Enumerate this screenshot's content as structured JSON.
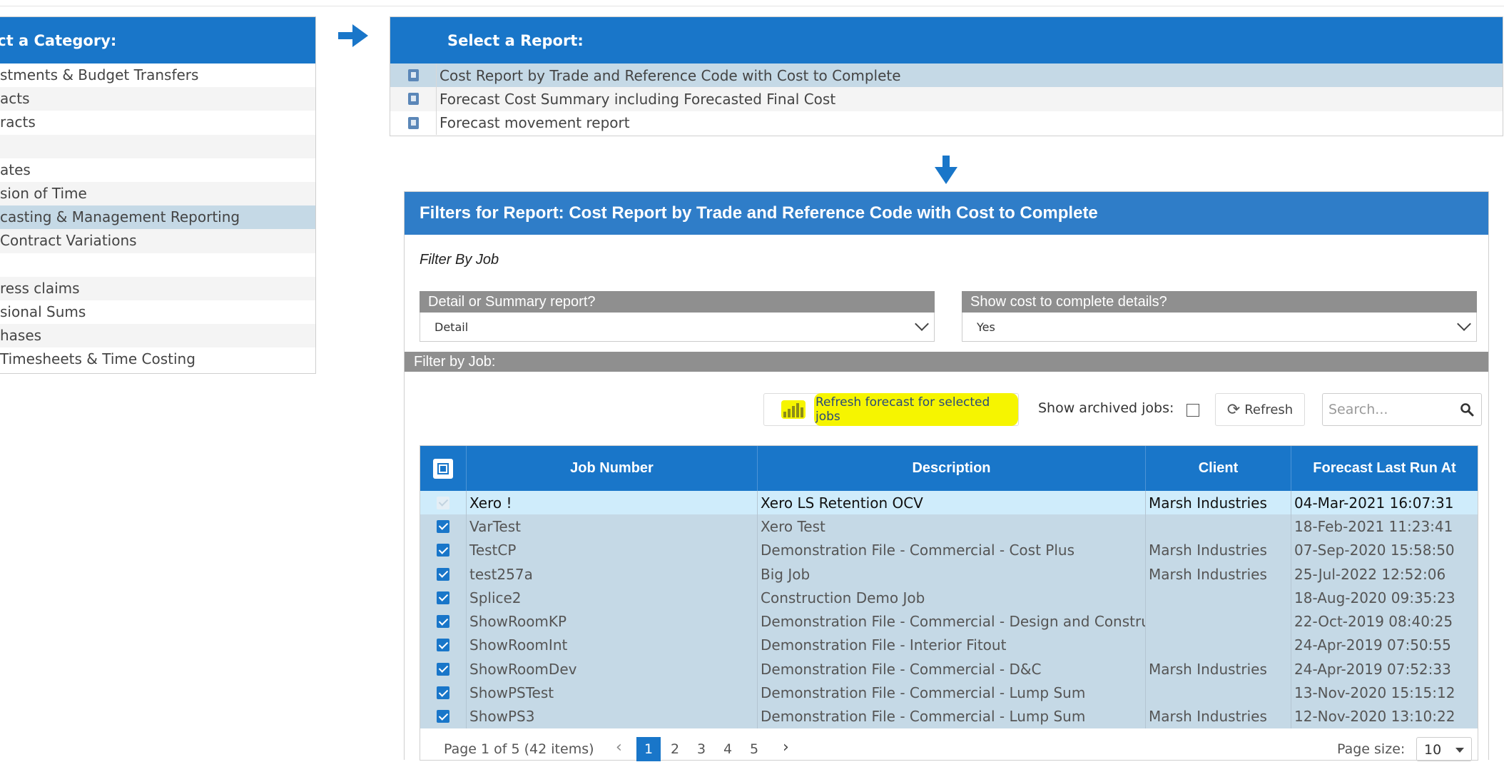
{
  "category_panel": {
    "header": "ect a Category:",
    "items": [
      "stments & Budget Transfers",
      "acts",
      "racts",
      "",
      "ates",
      "sion of Time",
      "casting & Management Reporting",
      " Contract Variations",
      "",
      "ress claims",
      "sional Sums",
      "hases",
      " Timesheets & Time Costing"
    ],
    "selected_index": 6
  },
  "report_panel": {
    "header": "Select a Report:",
    "items": [
      "Cost Report by Trade and Reference Code with Cost to Complete",
      "Forecast Cost Summary including Forecasted Final Cost",
      "Forecast movement report"
    ],
    "selected_index": 0
  },
  "filters": {
    "header": "Filters for Report: Cost Report by Trade and Reference Code with Cost to Complete",
    "filter_by_label": "Filter By Job",
    "detail_select": {
      "title": "Detail or Summary report?",
      "value": "Detail"
    },
    "cost_select": {
      "title": "Show cost to complete details?",
      "value": "Yes"
    },
    "job_bar": "Filter by Job:",
    "toolbar": {
      "forecast_button": "Refresh forecast for selected jobs",
      "archived_label": "Show archived jobs:",
      "refresh_button": "Refresh",
      "search_placeholder": "Search..."
    }
  },
  "grid": {
    "columns": [
      "Job Number",
      "Description",
      "Client",
      "Forecast Last Run At"
    ],
    "rows": [
      {
        "job": "Xero !",
        "description": "Xero LS Retention OCV",
        "client": "Marsh Industries",
        "forecast": "04-Mar-2021 16:07:31"
      },
      {
        "job": "VarTest",
        "description": "Xero Test",
        "client": "",
        "forecast": "18-Feb-2021 11:23:41"
      },
      {
        "job": "TestCP",
        "description": "Demonstration File - Commercial - Cost Plus",
        "client": "Marsh Industries",
        "forecast": "07-Sep-2020 15:58:50"
      },
      {
        "job": "test257a",
        "description": "Big Job",
        "client": "Marsh Industries",
        "forecast": "25-Jul-2022 12:52:06"
      },
      {
        "job": "Splice2",
        "description": "Construction Demo Job",
        "client": "",
        "forecast": "18-Aug-2020 09:35:23"
      },
      {
        "job": "ShowRoomKP",
        "description": "Demonstration File - Commercial - Design and Construct",
        "client": "",
        "forecast": "22-Oct-2019 08:40:25"
      },
      {
        "job": "ShowRoomInt",
        "description": "Demonstration File - Interior Fitout",
        "client": "",
        "forecast": "24-Apr-2019 07:50:55"
      },
      {
        "job": "ShowRoomDev",
        "description": "Demonstration File - Commercial - D&C",
        "client": "Marsh Industries",
        "forecast": "24-Apr-2019 07:52:33"
      },
      {
        "job": "ShowPSTest",
        "description": "Demonstration File - Commercial - Lump Sum",
        "client": "",
        "forecast": "13-Nov-2020 15:15:12"
      },
      {
        "job": "ShowPS3",
        "description": "Demonstration File - Commercial - Lump Sum",
        "client": "Marsh Industries",
        "forecast": "12-Nov-2020 13:10:22"
      }
    ]
  },
  "pager": {
    "info": "Page 1 of 5 (42 items)",
    "pages": [
      "1",
      "2",
      "3",
      "4",
      "5"
    ],
    "current_page": "1",
    "page_size_label": "Page size:",
    "page_size": "10"
  },
  "colors": {
    "primary": "#1976c9",
    "selected_row": "#c5d9e6",
    "highlight": "#f6f500",
    "section_bar": "#8f8f8f"
  }
}
